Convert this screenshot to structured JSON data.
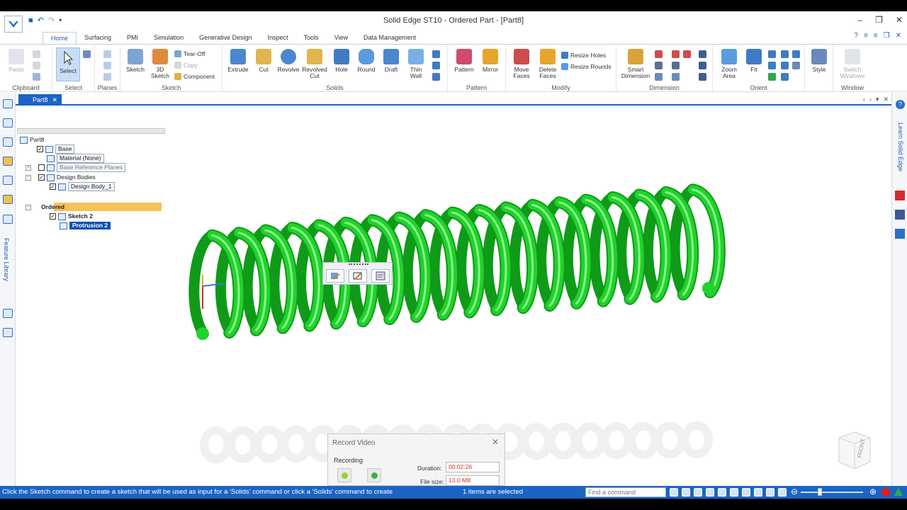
{
  "window": {
    "title": "Solid Edge ST10 - Ordered Part - [Part8]"
  },
  "ribbon": {
    "tabs": [
      "Home",
      "Surfacing",
      "PMI",
      "Simulation",
      "Generative Design",
      "Inspect",
      "Tools",
      "View",
      "Data Management"
    ],
    "active_tab": "Home",
    "groups": {
      "clipboard": {
        "label": "Clipboard",
        "paste": "Paste"
      },
      "select": {
        "label": "Select",
        "select": "Select"
      },
      "planes": {
        "label": "Planes"
      },
      "sketch": {
        "label": "Sketch",
        "sketch": "Sketch",
        "sketch3d_l1": "3D",
        "sketch3d_l2": "Sketch",
        "tearoff": "Tear-Off",
        "copy": "Copy",
        "component": "Component"
      },
      "solids": {
        "label": "Solids",
        "extrude": "Extrude",
        "cut": "Cut",
        "revolve": "Revolve",
        "revolved_cut_l1": "Revolved",
        "revolved_cut_l2": "Cut",
        "hole": "Hole",
        "round": "Round",
        "draft": "Draft",
        "thin_wall_l1": "Thin",
        "thin_wall_l2": "Wall"
      },
      "pattern": {
        "label": "Pattern",
        "pattern": "Pattern",
        "mirror": "Mirror"
      },
      "modify": {
        "label": "Modify",
        "move_faces_l1": "Move",
        "move_faces_l2": "Faces",
        "delete_faces_l1": "Delete",
        "delete_faces_l2": "Faces",
        "resize_holes": "Resize Holes",
        "resize_rounds": "Resize Rounds"
      },
      "dimension": {
        "label": "Dimension",
        "smart_l1": "Smart",
        "smart_l2": "Dimension"
      },
      "orient": {
        "label": "Orient",
        "zoom_area_l1": "Zoom",
        "zoom_area_l2": "Area",
        "fit": "Fit"
      },
      "style": {
        "style": "Style"
      },
      "window": {
        "label": "Window",
        "switch_l1": "Switch",
        "switch_l2": "Windows"
      }
    }
  },
  "document_tab": "Part8",
  "left_dock": {
    "feature_library": "Feature Library"
  },
  "right_dock": {
    "learn": "Learn Solid Edge"
  },
  "pathfinder": {
    "root": "Part8",
    "base": "Base",
    "material": "Material (None)",
    "base_ref_planes": "Base Reference Planes",
    "design_bodies": "Design Bodies",
    "design_body_1": "Design Body_1",
    "ordered": "Ordered",
    "sketch2": "Sketch 2",
    "protrusion2": "Protrusion 2"
  },
  "viewport": {
    "spring_color": "#1fd32a",
    "spring_shadow": "#0f9a18",
    "spring_highlight": "#8df28f",
    "viewcube_label": "FRONT"
  },
  "record_video": {
    "title": "Record Video",
    "status": "Recording",
    "duration_label": "Duration:",
    "duration_value": "00:02:26",
    "filesize_label": "File size:",
    "filesize_value": "13.0 MB"
  },
  "statusbar": {
    "prompt": "Click the Sketch command to create a sketch that will be used as input for a 'Solids' command or click a 'Solids' command to create",
    "selection": "1 items are selected",
    "find_placeholder": "Find a command"
  },
  "colors": {
    "accent": "#1b63c6",
    "ordered_bar": "#f6c15a",
    "selection": "#0a50b5",
    "recording_text": "#c0392b"
  }
}
